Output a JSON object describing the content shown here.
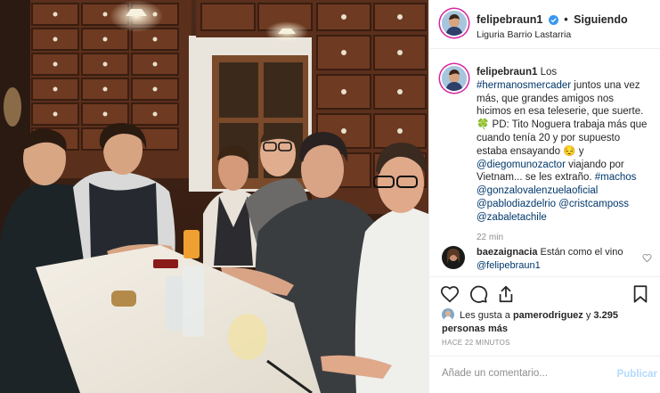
{
  "post": {
    "username": "felipebraun1",
    "follow_state": "Siguiendo",
    "location": "Liguria Barrio Lastarria",
    "verified": true
  },
  "caption": {
    "username": "felipebraun1",
    "segments": [
      {
        "text": "Los ",
        "type": "text"
      },
      {
        "text": "#hermanosmercader",
        "type": "link"
      },
      {
        "text": " juntos una vez más, que grandes amigos nos hicimos en esa teleserie, que suerte. ",
        "type": "text"
      },
      {
        "text": "🍀",
        "type": "text"
      },
      {
        "text": " PD: Tito Noguera trabaja más que cuando tenía 20 y por supuesto estaba ensayando ",
        "type": "text"
      },
      {
        "text": "😔",
        "type": "text"
      },
      {
        "text": " y ",
        "type": "text"
      },
      {
        "text": "@diegomunozactor",
        "type": "link"
      },
      {
        "text": " viajando por Vietnam... se les extraño. ",
        "type": "text"
      },
      {
        "text": "#machos",
        "type": "link"
      },
      {
        "text": " ",
        "type": "text"
      },
      {
        "text": "@gonzalovalenzuelaoficial",
        "type": "link"
      },
      {
        "text": " ",
        "type": "text"
      },
      {
        "text": "@pablodiazdelrio",
        "type": "link"
      },
      {
        "text": " ",
        "type": "text"
      },
      {
        "text": "@cristcamposs",
        "type": "link"
      },
      {
        "text": " ",
        "type": "text"
      },
      {
        "text": "@zabaletachile",
        "type": "link"
      }
    ],
    "time": "22 min"
  },
  "comment": {
    "username": "baezaignacia",
    "text": "Están como el vino",
    "mention": "@felipebraun1"
  },
  "likes": {
    "prefix": "Les gusta a ",
    "user": "pamerodriguez",
    "middle": " y ",
    "count": "3.295 personas más"
  },
  "posted_ago": "HACE 22 MINUTOS",
  "add_comment": {
    "placeholder": "Añade un comentario...",
    "publish_label": "Publicar"
  },
  "colors": {
    "link": "#00376b",
    "verified": "#3897f0",
    "publish_disabled": "#b3dbff",
    "story_ring": "#d6249f"
  },
  "icons": [
    "verified-badge-icon",
    "heart-icon",
    "comment-icon",
    "share-icon",
    "bookmark-icon",
    "small-heart-icon"
  ]
}
